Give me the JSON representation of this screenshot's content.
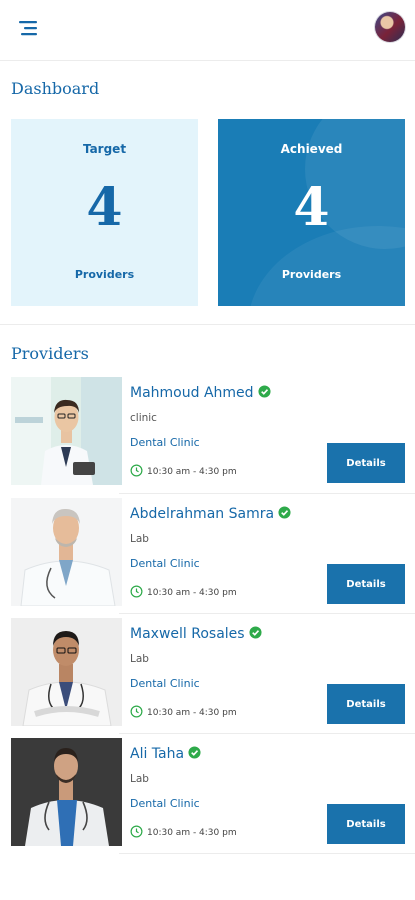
{
  "dashboard": {
    "title": "Dashboard",
    "target": {
      "label": "Target",
      "value": "4",
      "unit": "Providers"
    },
    "achieved": {
      "label": "Achieved",
      "value": "4",
      "unit": "Providers"
    }
  },
  "providers": {
    "title": "Providers",
    "details_label": "Details",
    "items": [
      {
        "name": "Mahmoud Ahmed",
        "type": "clinic",
        "clinic": "Dental Clinic",
        "time": "10:30 am - 4:30 pm"
      },
      {
        "name": "Abdelrahman Samra",
        "type": "Lab",
        "clinic": "Dental Clinic",
        "time": "10:30 am - 4:30 pm"
      },
      {
        "name": "Maxwell Rosales",
        "type": "Lab",
        "clinic": "Dental Clinic",
        "time": "10:30 am - 4:30 pm"
      },
      {
        "name": "Ali Taha",
        "type": "Lab",
        "clinic": "Dental Clinic",
        "time": "10:30 am - 4:30 pm"
      }
    ]
  },
  "colors": {
    "primary": "#1668a8",
    "accent": "#1a7db6",
    "light": "#e3f4fb",
    "verified": "#2eaa4a"
  },
  "icons": {
    "menu": "menu-icon",
    "verified": "verified-icon",
    "clock": "clock-icon"
  }
}
